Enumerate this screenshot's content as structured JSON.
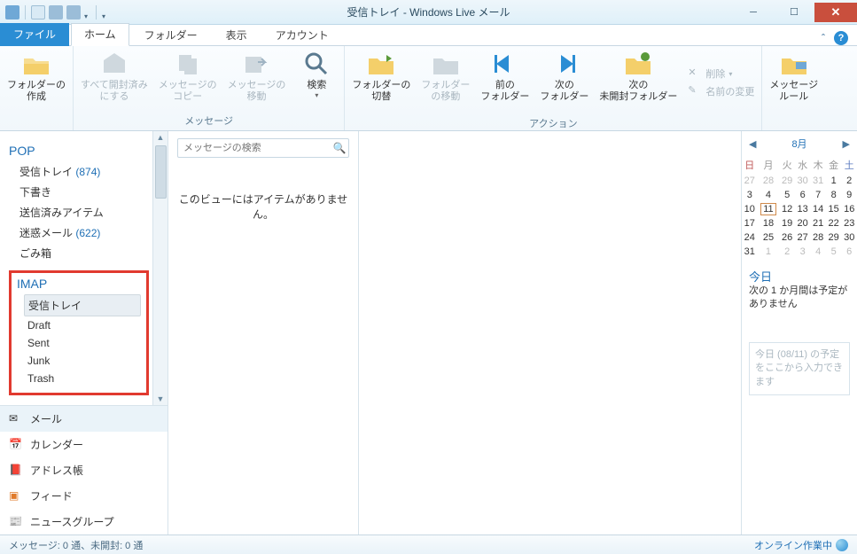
{
  "title": "受信トレイ - Windows Live メール",
  "tabs": {
    "file": "ファイル",
    "home": "ホーム",
    "folder": "フォルダー",
    "view": "表示",
    "account": "アカウント"
  },
  "ribbon": {
    "create_folder": "フォルダーの\n作成",
    "mark_all_read": "すべて開封済み\nにする",
    "copy_msg": "メッセージの\nコピー",
    "move_msg": "メッセージの\n移動",
    "search": "検索",
    "group_message": "メッセージ",
    "toggle_folder": "フォルダーの\n切替",
    "move_folder": "フォルダー\nの移動",
    "prev_folder": "前の\nフォルダー",
    "next_folder": "次の\nフォルダー",
    "next_unread_folder": "次の\n未開封フォルダー",
    "group_action": "アクション",
    "delete": "削除",
    "rename": "名前の変更",
    "msg_rules": "メッセージ\nルール"
  },
  "sidebar": {
    "pop": {
      "name": "POP",
      "inbox": "受信トレイ",
      "inbox_count": "(874)",
      "drafts": "下書き",
      "sent": "送信済みアイテム",
      "junk": "迷惑メール",
      "junk_count": "(622)",
      "trash": "ごみ箱"
    },
    "imap": {
      "name": "IMAP",
      "inbox": "受信トレイ",
      "draft": "Draft",
      "sent": "Sent",
      "junk": "Junk",
      "trash": "Trash"
    },
    "nav": {
      "mail": "メール",
      "calendar": "カレンダー",
      "contacts": "アドレス帳",
      "feeds": "フィード",
      "news": "ニュースグループ"
    }
  },
  "list": {
    "search_placeholder": "メッセージの検索",
    "empty": "このビューにはアイテムがありません。"
  },
  "calendar": {
    "month": "8月",
    "dows": [
      "日",
      "月",
      "火",
      "水",
      "木",
      "金",
      "土"
    ],
    "weeks": [
      [
        {
          "d": 27,
          "dim": 1
        },
        {
          "d": 28,
          "dim": 1
        },
        {
          "d": 29,
          "dim": 1
        },
        {
          "d": 30,
          "dim": 1
        },
        {
          "d": 31,
          "dim": 1
        },
        {
          "d": 1
        },
        {
          "d": 2
        }
      ],
      [
        {
          "d": 3
        },
        {
          "d": 4
        },
        {
          "d": 5
        },
        {
          "d": 6
        },
        {
          "d": 7
        },
        {
          "d": 8
        },
        {
          "d": 9
        }
      ],
      [
        {
          "d": 10
        },
        {
          "d": 11,
          "today": 1
        },
        {
          "d": 12
        },
        {
          "d": 13
        },
        {
          "d": 14
        },
        {
          "d": 15
        },
        {
          "d": 16
        }
      ],
      [
        {
          "d": 17
        },
        {
          "d": 18
        },
        {
          "d": 19
        },
        {
          "d": 20
        },
        {
          "d": 21
        },
        {
          "d": 22
        },
        {
          "d": 23
        }
      ],
      [
        {
          "d": 24
        },
        {
          "d": 25
        },
        {
          "d": 26
        },
        {
          "d": 27
        },
        {
          "d": 28
        },
        {
          "d": 29
        },
        {
          "d": 30
        }
      ],
      [
        {
          "d": 31
        },
        {
          "d": 1,
          "dim": 1
        },
        {
          "d": 2,
          "dim": 1
        },
        {
          "d": 3,
          "dim": 1
        },
        {
          "d": 4,
          "dim": 1
        },
        {
          "d": 5,
          "dim": 1
        },
        {
          "d": 6,
          "dim": 1
        }
      ]
    ],
    "today_title": "今日",
    "today_sub": "次の 1 か月間は予定がありません",
    "addbox": "今日 (08/11) の予定をここから入力できます"
  },
  "status": {
    "left": "メッセージ: 0 通、未開封: 0 通",
    "right": "オンライン作業中"
  }
}
